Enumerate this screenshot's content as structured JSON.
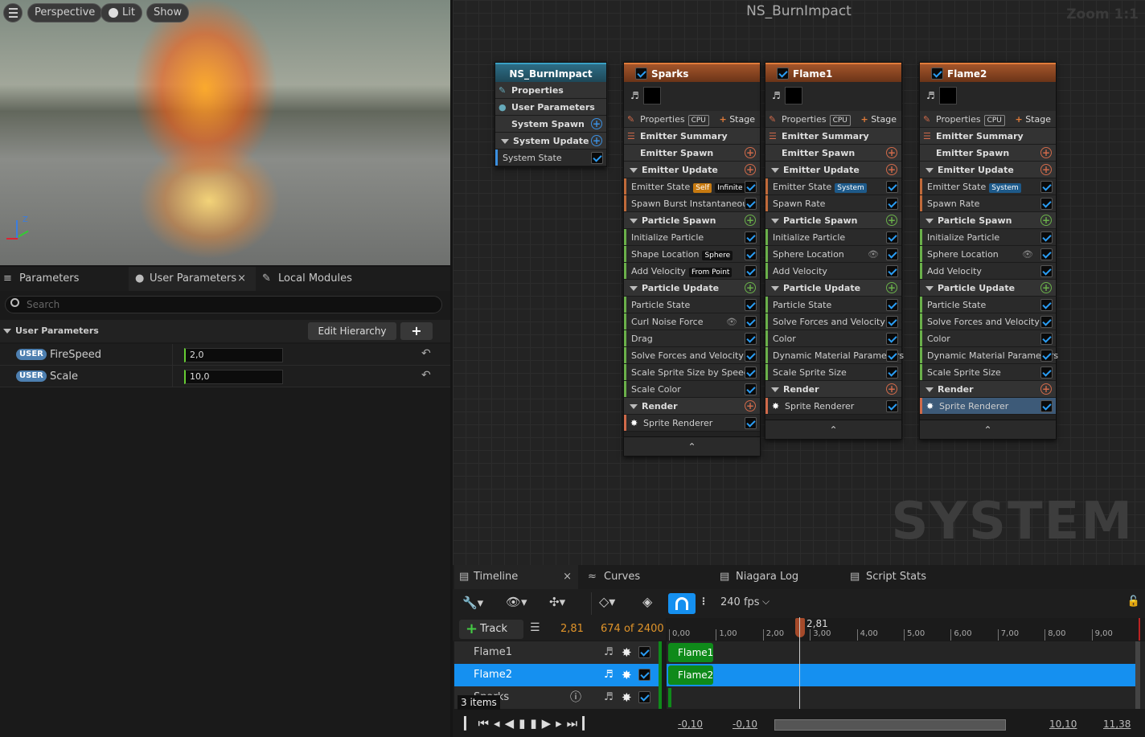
{
  "viewport": {
    "buttons": [
      "Perspective",
      "Lit",
      "Show"
    ],
    "axis_labels": {
      "z": "Z",
      "x": "x",
      "y": "y"
    }
  },
  "graph": {
    "title": "NS_BurnImpact",
    "zoom": "Zoom 1:1",
    "watermark": "SYSTEM",
    "system_node": {
      "title": "NS_BurnImpact",
      "rows": [
        "Properties",
        "User Parameters",
        "System Spawn",
        "System Update",
        "System State"
      ]
    },
    "emitters": [
      {
        "title": "Sparks",
        "properties": "Properties",
        "cpu": "CPU",
        "stage": "Stage",
        "summary": "Emitter Summary",
        "spawn": "Emitter Spawn",
        "update": "Emitter Update",
        "update_rows": [
          {
            "label": "Emitter State",
            "badges": [
              "Self",
              "Infinite"
            ]
          },
          {
            "label": "Spawn Burst Instantaneous",
            "badges": []
          }
        ],
        "particle_spawn": "Particle Spawn",
        "spawn_rows": [
          {
            "label": "Initialize Particle",
            "badges": []
          },
          {
            "label": "Shape Location",
            "badges": [
              "Sphere"
            ]
          },
          {
            "label": "Add Velocity",
            "badges": [
              "From Point"
            ]
          }
        ],
        "particle_update": "Particle Update",
        "particle_update_rows": [
          "Particle State",
          "Curl Noise Force",
          "Drag",
          "Solve Forces and Velocity",
          "Scale Sprite Size by Speed",
          "Scale Color"
        ],
        "render": "Render",
        "renderer": "Sprite Renderer"
      },
      {
        "title": "Flame1",
        "properties": "Properties",
        "cpu": "CPU",
        "stage": "Stage",
        "summary": "Emitter Summary",
        "spawn": "Emitter Spawn",
        "update": "Emitter Update",
        "update_rows": [
          {
            "label": "Emitter State",
            "badges": [
              "System"
            ]
          },
          {
            "label": "Spawn Rate",
            "badges": []
          }
        ],
        "particle_spawn": "Particle Spawn",
        "spawn_rows": [
          {
            "label": "Initialize Particle",
            "badges": []
          },
          {
            "label": "Sphere Location",
            "badges": []
          },
          {
            "label": "Add Velocity",
            "badges": []
          }
        ],
        "particle_update": "Particle Update",
        "particle_update_rows": [
          "Particle State",
          "Solve Forces and Velocity",
          "Color",
          "Dynamic Material Parameters",
          "Scale Sprite Size"
        ],
        "render": "Render",
        "renderer": "Sprite Renderer"
      },
      {
        "title": "Flame2",
        "properties": "Properties",
        "cpu": "CPU",
        "stage": "Stage",
        "summary": "Emitter Summary",
        "spawn": "Emitter Spawn",
        "update": "Emitter Update",
        "update_rows": [
          {
            "label": "Emitter State",
            "badges": [
              "System"
            ]
          },
          {
            "label": "Spawn Rate",
            "badges": []
          }
        ],
        "particle_spawn": "Particle Spawn",
        "spawn_rows": [
          {
            "label": "Initialize Particle",
            "badges": []
          },
          {
            "label": "Sphere Location",
            "badges": []
          },
          {
            "label": "Add Velocity",
            "badges": []
          }
        ],
        "particle_update": "Particle Update",
        "particle_update_rows": [
          "Particle State",
          "Solve Forces and Velocity",
          "Color",
          "Dynamic Material Parameters",
          "Scale Sprite Size"
        ],
        "render": "Render",
        "renderer": "Sprite Renderer"
      }
    ]
  },
  "params_panel": {
    "tabs": [
      "Parameters",
      "User Parameters",
      "Local Modules"
    ],
    "search_placeholder": "Search",
    "section": "User Parameters",
    "edit_hierarchy": "Edit Hierarchy",
    "params": [
      {
        "tag": "USER",
        "name": "FireSpeed",
        "value": "2,0"
      },
      {
        "tag": "USER",
        "name": "Scale",
        "value": "10,0"
      }
    ]
  },
  "timeline": {
    "tabs": [
      "Timeline",
      "Curves",
      "Niagara Log",
      "Script Stats"
    ],
    "fps": "240 fps",
    "track_button": "Track",
    "current_time": "2,81",
    "frame_counter": "674 of 2400",
    "playhead_label": "2,81",
    "ticks": [
      "0,00",
      "1,00",
      "2,00",
      "3,00",
      "4,00",
      "5,00",
      "6,00",
      "7,00",
      "8,00",
      "9,00"
    ],
    "tracks": [
      "Flame1",
      "Flame2",
      "Sparks"
    ],
    "items_count": "3 items",
    "range": {
      "start_a": "-0,10",
      "start_b": "-0,10",
      "end_a": "10,10",
      "end_b": "11,38"
    }
  },
  "colors": {
    "accent": "#0f8fff",
    "selection": "#1590f0",
    "clip": "#0f8a1a",
    "emitter_header": "#a4552a"
  }
}
